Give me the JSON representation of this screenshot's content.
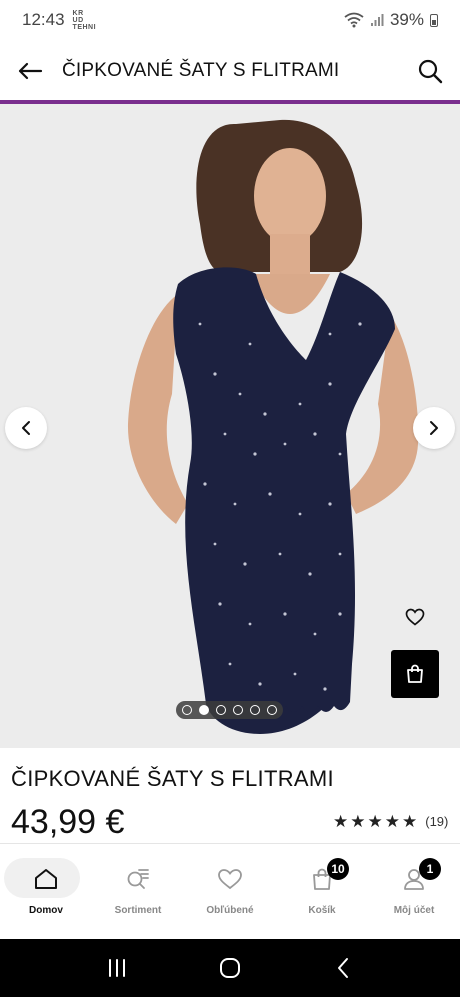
{
  "status_bar": {
    "time": "12:43",
    "mini_text": "KR UD TEHNI",
    "battery": "39%"
  },
  "header": {
    "title": "ČIPKOVANÉ ŠATY S FLITRAMI",
    "back_icon": "arrow-left-icon",
    "search_icon": "search-icon"
  },
  "accent_color": "#7a2f8e",
  "gallery": {
    "image_count": 6,
    "active_index": 1
  },
  "product": {
    "title": "ČIPKOVANÉ ŠATY S FLITRAMI",
    "price": "43,99 €",
    "rating_stars": 5,
    "rating_count": "(19)"
  },
  "bottom_nav": {
    "items": [
      {
        "label": "Domov",
        "icon": "home-icon",
        "badge": ""
      },
      {
        "label": "Sortiment",
        "icon": "category-search-icon",
        "badge": ""
      },
      {
        "label": "Obľúbené",
        "icon": "heart-icon",
        "badge": ""
      },
      {
        "label": "Košík",
        "icon": "shopping-bag-icon",
        "badge": "10"
      },
      {
        "label": "Môj účet",
        "icon": "user-icon",
        "badge": "1"
      }
    ]
  }
}
